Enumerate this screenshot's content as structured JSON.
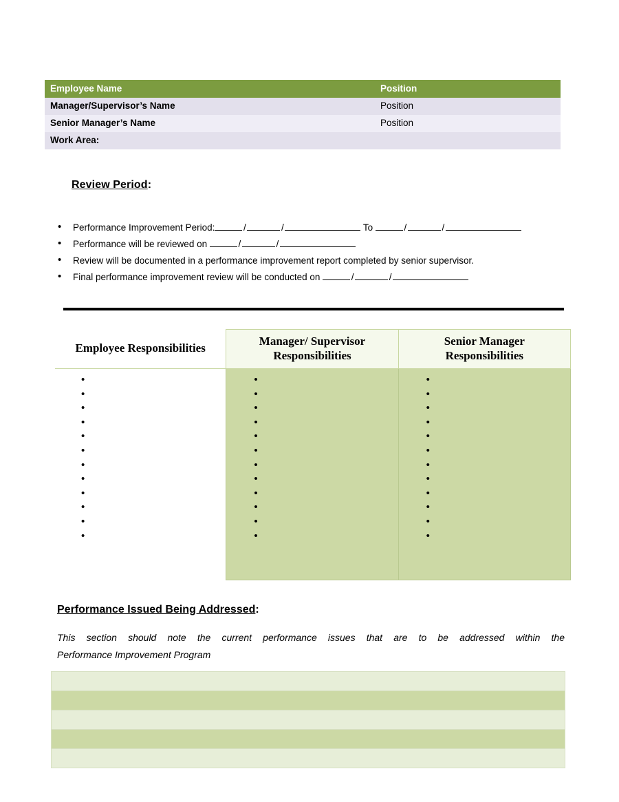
{
  "info_table": {
    "headers": [
      "Employee Name",
      "Position"
    ],
    "rows": [
      {
        "label": "Manager/Supervisor’s Name",
        "value": "Position"
      },
      {
        "label": "Senior Manager’s Name",
        "value": "Position"
      },
      {
        "label": "Work Area:",
        "value": ""
      }
    ],
    "header_bg": "#7c9c40",
    "row_dark_bg": "#e3e0ec",
    "row_light_bg": "#efedf6"
  },
  "review_section": {
    "heading": "Review Period",
    "heading_colon": ":",
    "bullets": {
      "b1_pre": "Performance Improvement Period:",
      "b1_mid": "To",
      "b2_pre": "Performance will be reviewed on",
      "b3": "Review will be documented in a performance improvement report completed by senior supervisor.",
      "b4_pre": "Final performance improvement review will be conducted on"
    }
  },
  "responsibilities": {
    "headers": [
      "Employee Responsibilities",
      "Manager/ Supervisor Responsibilities",
      "Senior Manager Responsibilities"
    ],
    "header_line1": [
      "Employee Responsibilities",
      "Manager/ Supervisor",
      "Senior Manager"
    ],
    "header_line2": [
      "",
      "Responsibilities",
      "Responsibilities"
    ],
    "bullet_counts": [
      12,
      12,
      12
    ],
    "cell_green": "#ccd9a5",
    "header_green": "#f5f9ec"
  },
  "issues_section": {
    "heading": "Performance Issued Being Addressed",
    "heading_colon": ":",
    "note_line1": "This section should note the current performance issues that are to be addressed within the",
    "note_line2": "Performance Improvement Program"
  },
  "notes_table": {
    "row_count": 5,
    "row_light_bg": "#e7eed8",
    "row_dark_bg": "#ccd9a5",
    "rows": [
      "",
      "",
      "",
      "",
      ""
    ]
  }
}
